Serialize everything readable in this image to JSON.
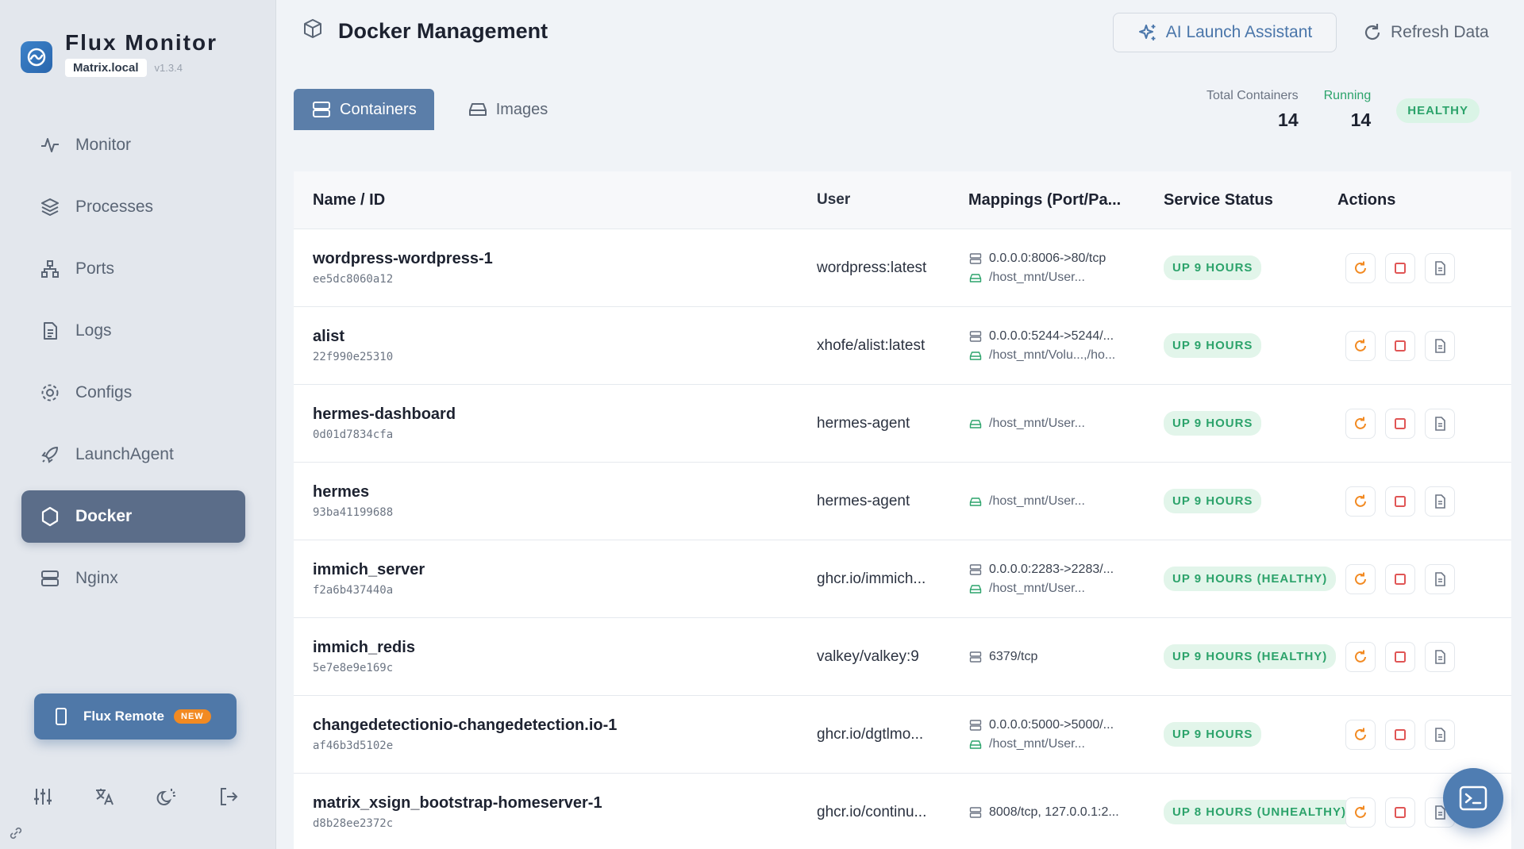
{
  "app": {
    "title": "Flux Monitor",
    "host": "Matrix.local",
    "version": "v1.3.4"
  },
  "nav": [
    {
      "label": "Monitor",
      "icon": "activity-icon"
    },
    {
      "label": "Processes",
      "icon": "layers-icon"
    },
    {
      "label": "Ports",
      "icon": "network-icon"
    },
    {
      "label": "Logs",
      "icon": "file-icon"
    },
    {
      "label": "Configs",
      "icon": "gear-icon"
    },
    {
      "label": "LaunchAgent",
      "icon": "rocket-icon"
    },
    {
      "label": "Docker",
      "icon": "hexagon-icon",
      "active": true
    },
    {
      "label": "Nginx",
      "icon": "server-icon"
    }
  ],
  "remote": {
    "label": "Flux Remote",
    "badge": "NEW"
  },
  "header": {
    "title": "Docker Management",
    "ai_label": "AI Launch Assistant",
    "refresh_label": "Refresh Data"
  },
  "tabs": [
    {
      "label": "Containers",
      "active": true
    },
    {
      "label": "Images"
    }
  ],
  "stats": {
    "total_label": "Total Containers",
    "total_value": "14",
    "running_label": "Running",
    "running_value": "14",
    "health": "HEALTHY"
  },
  "table": {
    "headers": {
      "name": "Name / ID",
      "user": "User",
      "mappings": "Mappings (Port/Pa...",
      "status": "Service Status",
      "actions": "Actions"
    },
    "rows": [
      {
        "name": "wordpress-wordpress-1",
        "id": "ee5dc8060a12",
        "user": "wordpress:latest",
        "port": "0.0.0.0:8006->80/tcp",
        "path": "/host_mnt/User...",
        "status": "UP 9 HOURS"
      },
      {
        "name": "alist",
        "id": "22f990e25310",
        "user": "xhofe/alist:latest",
        "port": "0.0.0.0:5244->5244/...",
        "path": "/host_mnt/Volu...,/ho...",
        "status": "UP 9 HOURS"
      },
      {
        "name": "hermes-dashboard",
        "id": "0d01d7834cfa",
        "user": "hermes-agent",
        "port": "",
        "path": "/host_mnt/User...",
        "status": "UP 9 HOURS"
      },
      {
        "name": "hermes",
        "id": "93ba41199688",
        "user": "hermes-agent",
        "port": "",
        "path": "/host_mnt/User...",
        "status": "UP 9 HOURS"
      },
      {
        "name": "immich_server",
        "id": "f2a6b437440a",
        "user": "ghcr.io/immich...",
        "port": "0.0.0.0:2283->2283/...",
        "path": "/host_mnt/User...",
        "status": "UP 9 HOURS (HEALTHY)"
      },
      {
        "name": "immich_redis",
        "id": "5e7e8e9e169c",
        "user": "valkey/valkey:9",
        "port": "6379/tcp",
        "path": "",
        "status": "UP 9 HOURS (HEALTHY)"
      },
      {
        "name": "changedetectionio-changedetection.io-1",
        "id": "af46b3d5102e",
        "user": "ghcr.io/dgtlmo...",
        "port": "0.0.0.0:5000->5000/...",
        "path": "/host_mnt/User...",
        "status": "UP 9 HOURS"
      },
      {
        "name": "matrix_xsign_bootstrap-homeserver-1",
        "id": "d8b28ee2372c",
        "user": "ghcr.io/continu...",
        "port": "8008/tcp, 127.0.0.1:2...",
        "path": "",
        "status": "UP 8 HOURS (UNHEALTHY)"
      }
    ]
  },
  "colors": {
    "accent": "#5b7ea9",
    "nav_active": "#5b6d89",
    "success": "#2ca36b",
    "warning": "#f28a22",
    "danger": "#e05555"
  }
}
